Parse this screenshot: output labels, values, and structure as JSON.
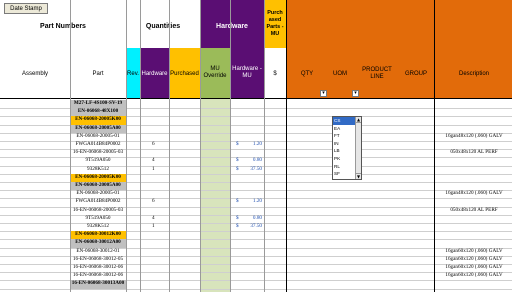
{
  "toolbar": {
    "date_stamp_label": "Date Stamp"
  },
  "headers": {
    "part_numbers": "Part Numbers",
    "quantities": "Quantities",
    "hardware_group": "Hardware",
    "purchased_parts_mu": "Purch ased Parts - MU",
    "assembly": "Assembly",
    "part": "Part",
    "rev": "Rev.",
    "hardware": "Hardware",
    "purchased": "Purchased",
    "mu_override": "MU Override",
    "hardware_mu": "Hardware - MU",
    "dollar": "$",
    "qty": "QTY",
    "uom": "UOM",
    "product_line": "PRODUCT LINE",
    "group": "GROUP",
    "description": "Description"
  },
  "colors": {
    "part_header_bg": "#ffffff",
    "rev_bg": "#00f0ff",
    "hardware_bg": "#5a0e73",
    "purchased_bg": "#ffc000",
    "mu_override_bg": "#9bbb59",
    "purch_parts_bg": "#ffc000",
    "orange_bg": "#e26b0a",
    "highlight_row": "#ffc000",
    "gray_row": "#c0c0c0",
    "green_col": "#d8e4bc"
  },
  "rows": [
    {
      "part": "M27-LF-4S100-SV-19",
      "style": "gray"
    },
    {
      "part": "EN-06068-48X100",
      "style": "gray"
    },
    {
      "part": "EN-06068-20005K00",
      "style": "orange"
    },
    {
      "part": "EN-06068-20005A00",
      "style": "gray"
    },
    {
      "part": "EN-06068-20005-01",
      "style": "plain"
    },
    {
      "part": "FWGA014B84P0002",
      "style": "plain",
      "hardware": "6",
      "dollar": "$",
      "price": "1.20"
    },
    {
      "part": "16-EN-06068-20005-03",
      "style": "plain"
    },
    {
      "part": "9T519A050",
      "style": "plain",
      "hardware": "4",
      "dollar": "$",
      "price": "0.80"
    },
    {
      "part": "9328K512",
      "style": "plain",
      "hardware": "1",
      "dollar": "$",
      "price": "37.50"
    },
    {
      "part": "EN-06068-20005K00",
      "style": "orange"
    },
    {
      "part": "EN-06068-20005A00",
      "style": "gray"
    },
    {
      "part": "EN-06068-20005-01",
      "style": "plain"
    },
    {
      "part": "FWGA014B84P0002",
      "style": "plain",
      "hardware": "6",
      "dollar": "$",
      "price": "1.20"
    },
    {
      "part": "16-EN-06068-20005-03",
      "style": "plain"
    },
    {
      "part": "9T519A050",
      "style": "plain",
      "hardware": "4",
      "dollar": "$",
      "price": "0.80"
    },
    {
      "part": "9328K512",
      "style": "plain",
      "hardware": "1",
      "dollar": "$",
      "price": "37.50"
    },
    {
      "part": "EN-06068-30012K00",
      "style": "orange"
    },
    {
      "part": "EN-06068-30012A00",
      "style": "gray"
    },
    {
      "part": "EN-06068-30012-01",
      "style": "plain"
    },
    {
      "part": "16-EN-06068-30012-05",
      "style": "plain"
    },
    {
      "part": "16-EN-06068-30012-06",
      "style": "plain"
    },
    {
      "part": "16-EN-06068-30012-06",
      "style": "plain"
    },
    {
      "part": "16-EN-06068-30013A00",
      "style": "gray"
    }
  ],
  "descriptions": [
    {
      "row": 4,
      "text": "16gan48x120 (.060) GALV"
    },
    {
      "row": 6,
      "text": "050x48x120 AL PERF"
    },
    {
      "row": 11,
      "text": "16gan48x120 (.060) GALV"
    },
    {
      "row": 13,
      "text": "050x48x120 AL PERF"
    },
    {
      "row": 18,
      "text": "16gan60x120 (.060) GALV"
    },
    {
      "row": 19,
      "text": "16gan60x120 (.060) GALV"
    },
    {
      "row": 20,
      "text": "16gan60x120 (.060) GALV"
    },
    {
      "row": 21,
      "text": "16gan60x120 (.060) GALV"
    }
  ],
  "uom_dropdown": {
    "selected": "CS",
    "options": [
      "CS",
      "EA",
      "FT",
      "IN",
      "LB",
      "PK",
      "RL",
      "SF"
    ]
  }
}
